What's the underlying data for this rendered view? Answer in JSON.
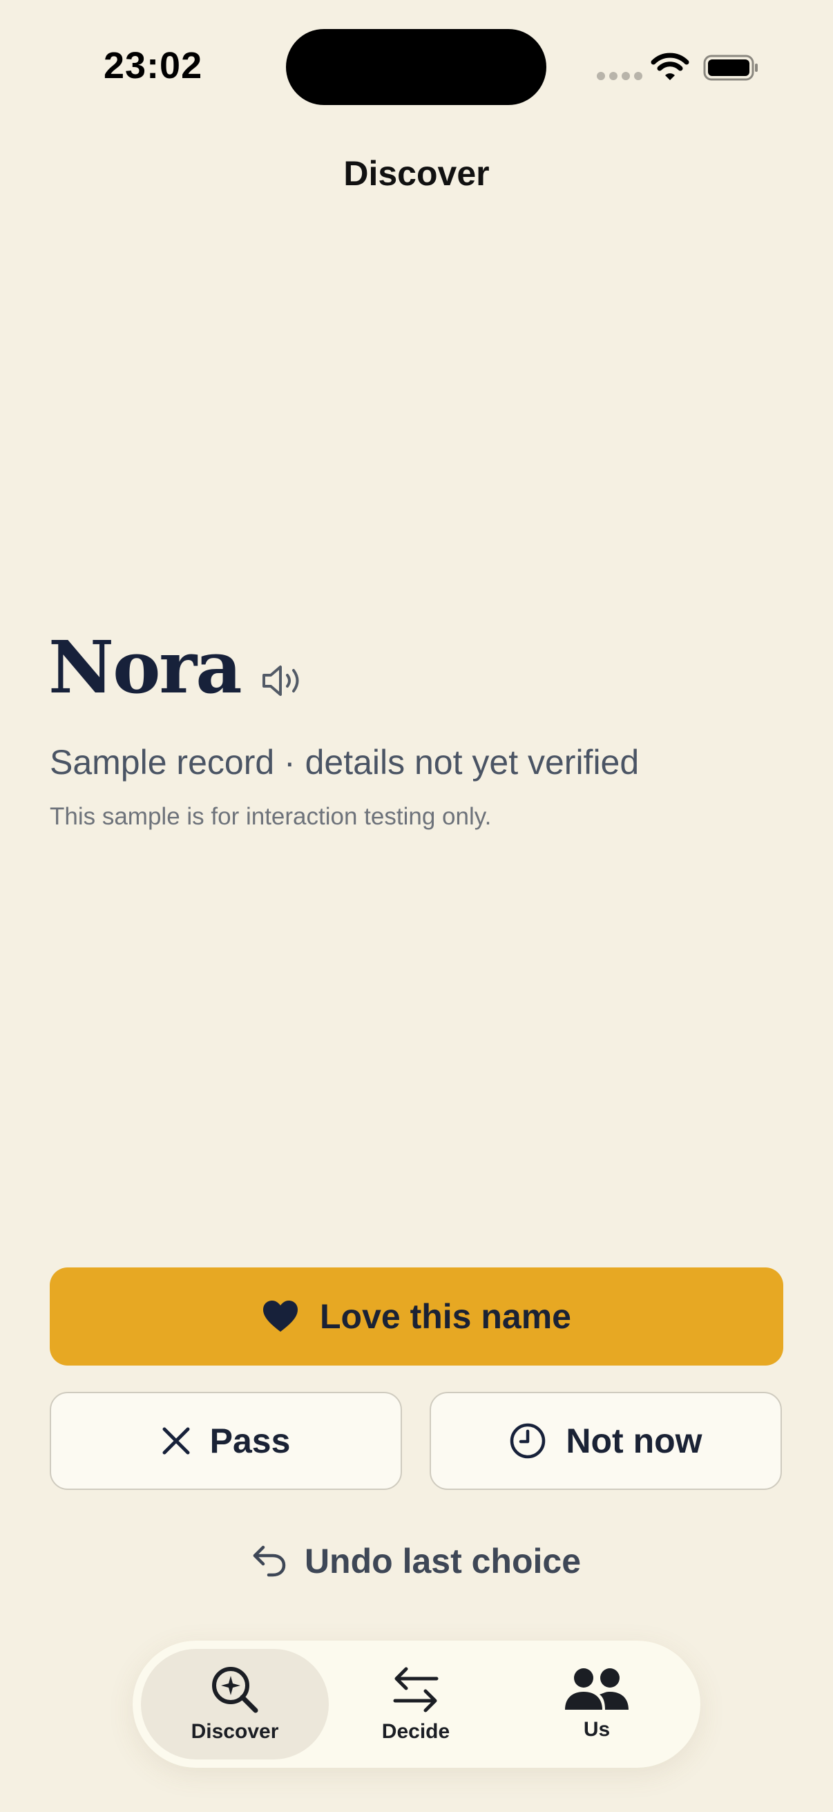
{
  "status_bar": {
    "time": "23:02"
  },
  "header": {
    "title": "Discover"
  },
  "name_card": {
    "name": "Nora",
    "subtitle": "Sample record · details not yet verified",
    "note": "This sample is for interaction testing only."
  },
  "actions": {
    "love_label": "Love this name",
    "pass_label": "Pass",
    "not_now_label": "Not now",
    "undo_label": "Undo last choice"
  },
  "tabs": [
    {
      "label": "Discover",
      "icon": "sparkle-search-icon",
      "selected": true
    },
    {
      "label": "Decide",
      "icon": "swap-arrows-icon",
      "selected": false
    },
    {
      "label": "Us",
      "icon": "people-icon",
      "selected": false
    }
  ],
  "colors": {
    "background": "#f5f0e2",
    "accent": "#e7a823",
    "text_primary": "#17213a",
    "text_secondary": "#4a5464"
  }
}
